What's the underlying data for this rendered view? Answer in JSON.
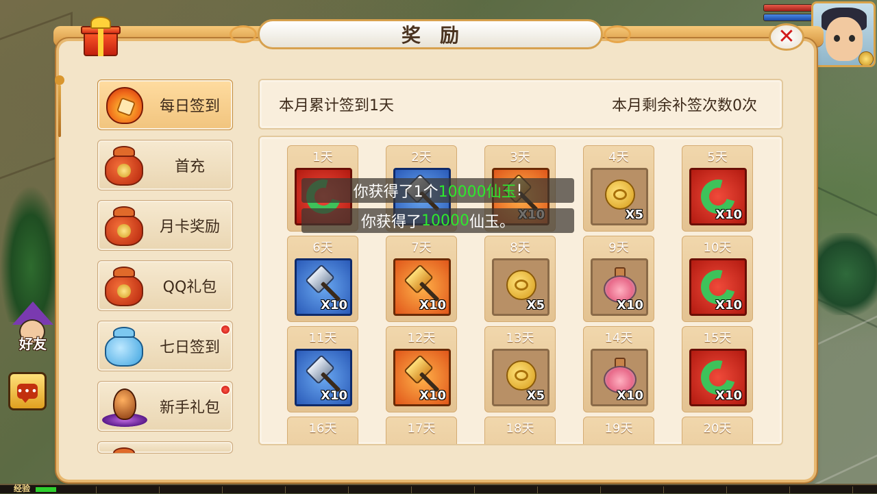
{
  "panel": {
    "title": "奖励",
    "close_icon": "close-icon"
  },
  "tabs": [
    {
      "label": "每日签到",
      "icon": "flame-badge-icon",
      "active": true,
      "badge": false
    },
    {
      "label": "首充",
      "icon": "money-bag-icon",
      "active": false,
      "badge": false
    },
    {
      "label": "月卡奖励",
      "icon": "money-bag-icon",
      "active": false,
      "badge": false
    },
    {
      "label": "QQ礼包",
      "icon": "money-bag-icon",
      "active": false,
      "badge": false
    },
    {
      "label": "七日签到",
      "icon": "blue-bag-icon",
      "active": false,
      "badge": true
    },
    {
      "label": "新手礼包",
      "icon": "egg-icon",
      "active": false,
      "badge": true
    }
  ],
  "info": {
    "signed_text": "本月累计签到1天",
    "makeup_text": "本月剩余补签次数0次"
  },
  "days": [
    {
      "day": "1天",
      "item": "jade-ring",
      "qty": ""
    },
    {
      "day": "2天",
      "item": "silver-axe",
      "qty": ""
    },
    {
      "day": "3天",
      "item": "gold-axe",
      "qty": "X10"
    },
    {
      "day": "4天",
      "item": "coin",
      "qty": "X5"
    },
    {
      "day": "5天",
      "item": "jade-ring",
      "qty": "X10"
    },
    {
      "day": "6天",
      "item": "silver-axe",
      "qty": "X10"
    },
    {
      "day": "7天",
      "item": "gold-axe",
      "qty": "X10"
    },
    {
      "day": "8天",
      "item": "coin",
      "qty": "X5"
    },
    {
      "day": "9天",
      "item": "potion",
      "qty": "X10"
    },
    {
      "day": "10天",
      "item": "jade-ring",
      "qty": "X10"
    },
    {
      "day": "11天",
      "item": "silver-axe",
      "qty": "X10"
    },
    {
      "day": "12天",
      "item": "gold-axe",
      "qty": "X10"
    },
    {
      "day": "13天",
      "item": "coin",
      "qty": "X5"
    },
    {
      "day": "14天",
      "item": "potion",
      "qty": "X10"
    },
    {
      "day": "15天",
      "item": "jade-ring",
      "qty": "X10"
    },
    {
      "day": "16天"
    },
    {
      "day": "17天"
    },
    {
      "day": "18天"
    },
    {
      "day": "19天"
    },
    {
      "day": "20天"
    }
  ],
  "toasts": [
    {
      "pre": "你获得了1个",
      "highlight": "10000仙玉",
      "post": "!"
    },
    {
      "pre": "你获得了",
      "highlight": "10000",
      "post": "仙玉。"
    }
  ],
  "side": {
    "friend_label": "好友",
    "chat_icon": "chat-bubble-icon",
    "chat_glyph": "•••"
  },
  "exp_bar": {
    "label": "经验"
  },
  "colors": {
    "highlight": "#2ee82e",
    "accent": "#d7a14e",
    "badge": "#c0100a"
  }
}
